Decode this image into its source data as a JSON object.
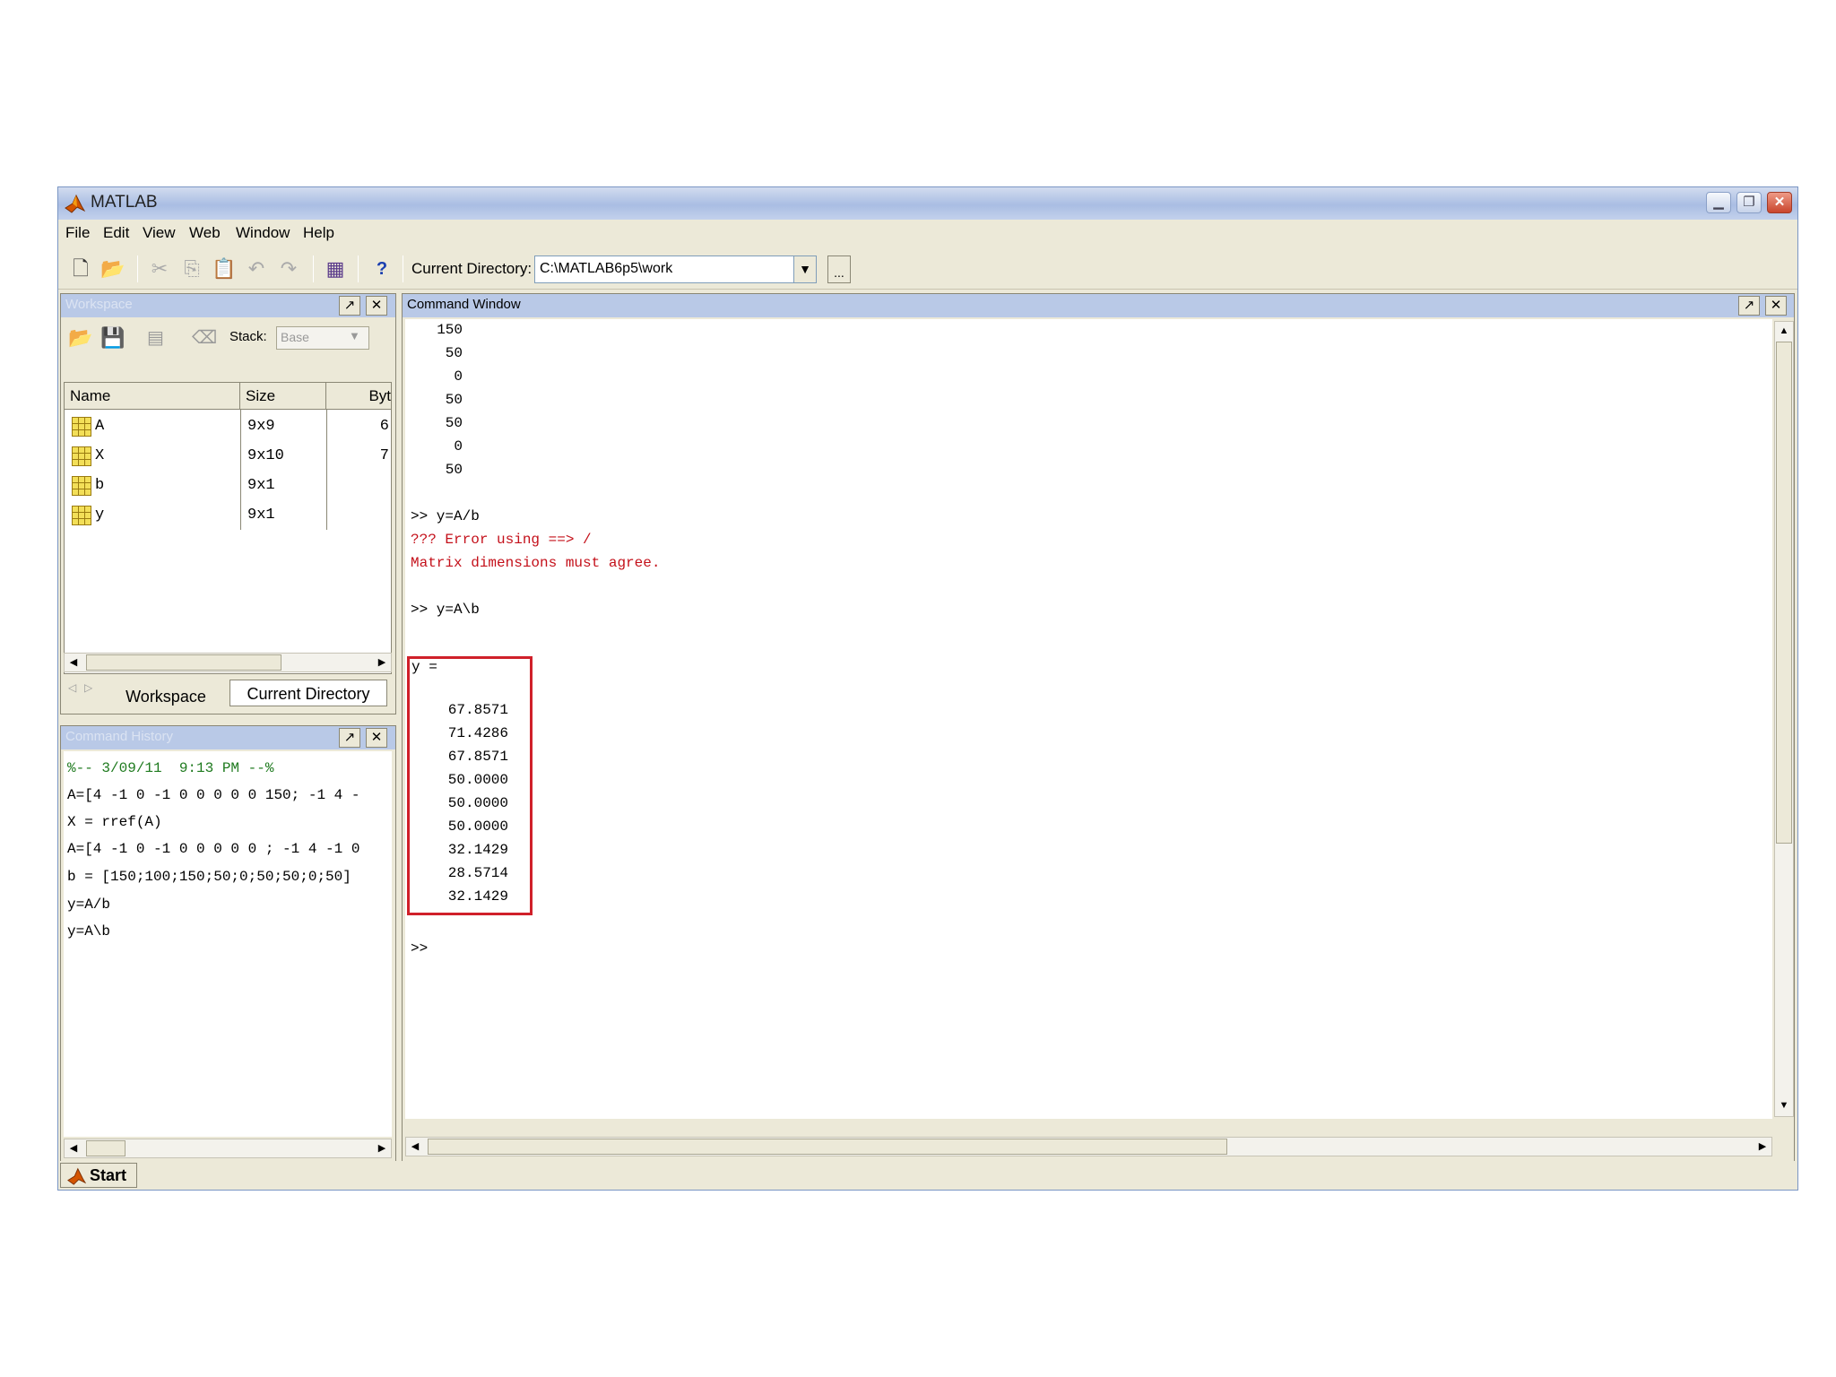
{
  "window": {
    "title": "MATLAB",
    "menu": [
      "File",
      "Edit",
      "View",
      "Web",
      "Window",
      "Help"
    ]
  },
  "toolbar": {
    "current_directory_label": "Current Directory:",
    "current_directory_value": "C:\\MATLAB6p5\\work",
    "browse_label": "...",
    "help_label": "?"
  },
  "workspace": {
    "title": "Workspace",
    "stack_label": "Stack:",
    "stack_value": "Base",
    "columns": [
      "Name",
      "Size",
      "Byt"
    ],
    "rows": [
      {
        "name": "A",
        "size": "9x9",
        "bytes": "6"
      },
      {
        "name": "X",
        "size": "9x10",
        "bytes": "7"
      },
      {
        "name": "b",
        "size": "9x1",
        "bytes": ""
      },
      {
        "name": "y",
        "size": "9x1",
        "bytes": ""
      }
    ],
    "tabs": [
      "Workspace",
      "Current Directory"
    ]
  },
  "history": {
    "title": "Command History",
    "lines": [
      "%-- 3/09/11  9:13 PM --%",
      "A=[4 -1 0 -1 0 0 0 0 0 150; -1 4 -",
      "X = rref(A)",
      "A=[4 -1 0 -1 0 0 0 0 0 ; -1 4 -1 0",
      "b = [150;100;150;50;0;50;50;0;50]",
      "y=A/b",
      "y=A\\b"
    ]
  },
  "command_window": {
    "title": "Command Window",
    "prev_output": [
      "150",
      "50",
      "0",
      "50",
      "50",
      "0",
      "50"
    ],
    "cmd1": ">> y=A/b",
    "error_line1": "??? Error using ==> /",
    "error_line2": "Matrix dimensions must agree.",
    "cmd2": ">> y=A\\b",
    "result_label": "y =",
    "result_values": [
      "67.8571",
      "71.4286",
      "67.8571",
      "50.0000",
      "50.0000",
      "50.0000",
      "32.1429",
      "28.5714",
      "32.1429"
    ],
    "prompt": ">>"
  },
  "statusbar": {
    "start_label": "Start"
  },
  "colors": {
    "titlebar": "#b9c9e7",
    "error_text": "#c4101a",
    "highlight_box": "#d0202a",
    "history_timestamp": "#1e7a1e"
  }
}
